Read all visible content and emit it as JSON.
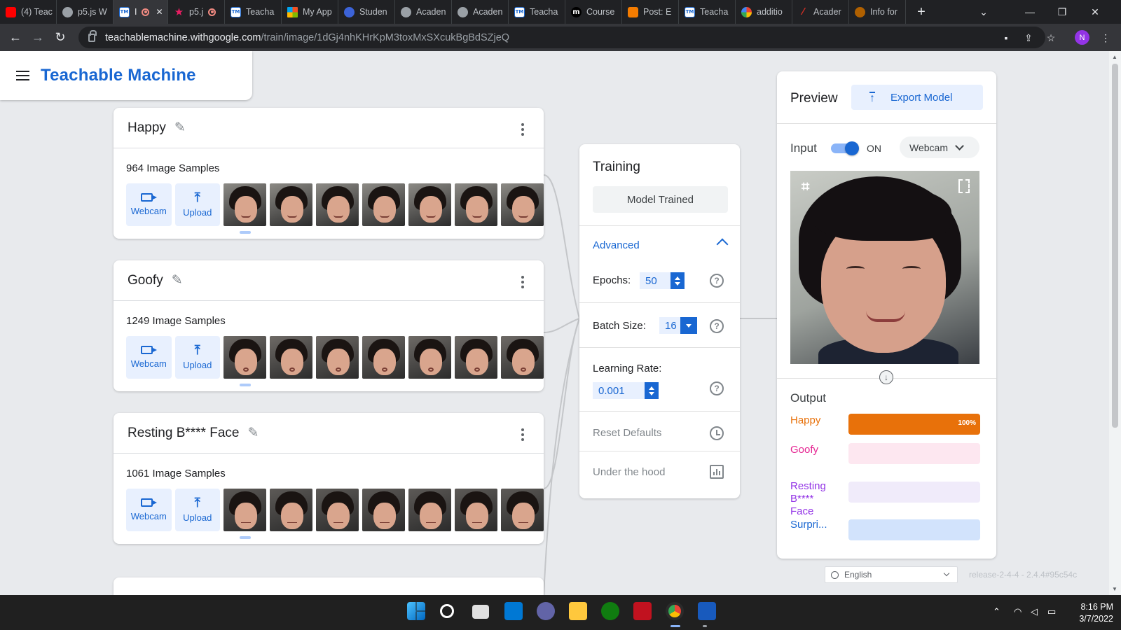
{
  "browser": {
    "tabs": [
      {
        "title": "(4) Teac",
        "icon": "youtube-icon"
      },
      {
        "title": "p5.js W",
        "icon": "globe-icon"
      },
      {
        "title": "I",
        "icon": "teachable-machine-icon",
        "active": true,
        "recording": true
      },
      {
        "title": "p5.j",
        "icon": "star-icon",
        "recording": true
      },
      {
        "title": "Teacha",
        "icon": "teachable-machine-icon"
      },
      {
        "title": "My App",
        "icon": "microsoft-icon"
      },
      {
        "title": "Studen",
        "icon": "student-icon"
      },
      {
        "title": "Acaden",
        "icon": "globe-icon"
      },
      {
        "title": "Acaden",
        "icon": "globe-icon"
      },
      {
        "title": "Teacha",
        "icon": "teachable-machine-icon"
      },
      {
        "title": "Course",
        "icon": "m-icon"
      },
      {
        "title": "Post: E",
        "icon": "blogger-icon"
      },
      {
        "title": "Teacha",
        "icon": "teachable-machine-icon"
      },
      {
        "title": "additio",
        "icon": "google-icon"
      },
      {
        "title": "Acader",
        "icon": "academic-icon"
      },
      {
        "title": "Info for",
        "icon": "shield-icon"
      }
    ],
    "new_tab_label": "+",
    "url_host": "teachablemachine.withgoogle.com",
    "url_path": "/train/image/1dGj4nhKHrKpM3toxMxSXcukBgBdSZjeQ",
    "profile_initial": "N"
  },
  "app": {
    "title": "Teachable Machine",
    "classes": [
      {
        "name": "Happy",
        "samples": "964 Image Samples",
        "webcam": "Webcam",
        "upload": "Upload",
        "style": "happy"
      },
      {
        "name": "Goofy",
        "samples": "1249 Image Samples",
        "webcam": "Webcam",
        "upload": "Upload",
        "style": "goofy"
      },
      {
        "name": "Resting B**** Face",
        "samples": "1061 Image Samples",
        "webcam": "Webcam",
        "upload": "Upload",
        "style": "rest"
      }
    ],
    "training": {
      "title": "Training",
      "button": "Model Trained",
      "advanced": "Advanced",
      "epochs_label": "Epochs:",
      "epochs": "50",
      "batch_label": "Batch Size:",
      "batch": "16",
      "lr_label": "Learning Rate:",
      "lr": "0.001",
      "reset": "Reset Defaults",
      "under_hood": "Under the hood"
    },
    "preview": {
      "title": "Preview",
      "export": "Export Model",
      "input_label": "Input",
      "toggle_state": "ON",
      "source": "Webcam",
      "output_label": "Output",
      "outputs": [
        {
          "label": "Happy",
          "value": 100,
          "pct_text": "100%",
          "color": "#e8710a",
          "bg": "#fce8d6"
        },
        {
          "label": "Goofy",
          "value": 0,
          "pct_text": "",
          "color": "#e52592",
          "bg": "#fde7f0"
        },
        {
          "label": "Resting B**** Face",
          "value": 0,
          "pct_text": "",
          "color": "#9334e6",
          "bg": "#f0ebfa"
        },
        {
          "label": "Surpri...",
          "value": 0,
          "pct_text": "",
          "color": "#1967d2",
          "bg": "#d2e3fc"
        }
      ]
    },
    "language": "English",
    "release": "release-2-4-4 - 2.4.4#95c54c"
  },
  "taskbar": {
    "time": "8:16 PM",
    "date": "3/7/2022"
  }
}
